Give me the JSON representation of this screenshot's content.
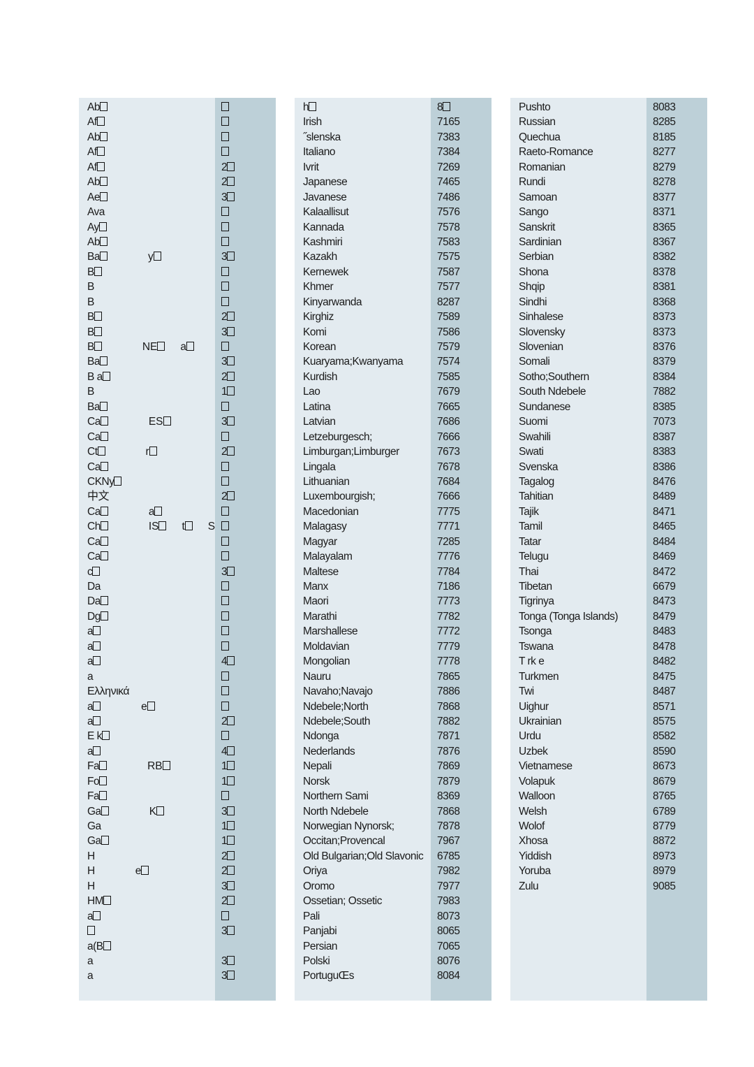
{
  "page": {
    "background": "#ffffff",
    "panel_name_bg": "#e3ebf0",
    "panel_code_bg": "#bdd0d8",
    "text_color": "#1a1a1a",
    "description": "Language code reference table, three columns. First column renders with missing font glyphs (tofu boxes)."
  },
  "columns": [
    {
      "name": "column-1-corrupted",
      "legible": false,
      "note": "Glyphs fail to render; shown as overlapping letters and empty boxes.",
      "rows": [
        {
          "name_text": "Ab",
          "name_boxes": 1,
          "code_text": "",
          "code_boxes": 1
        },
        {
          "name_text": "Af",
          "name_boxes": 1,
          "code_text": "",
          "code_boxes": 1
        },
        {
          "name_text": "Ab",
          "name_boxes": 1,
          "code_text": "",
          "code_boxes": 1
        },
        {
          "name_text": "Af",
          "name_boxes": 1,
          "code_text": "",
          "code_boxes": 1
        },
        {
          "name_text": "Af",
          "name_boxes": 1,
          "code_text": "2",
          "code_boxes": 1
        },
        {
          "name_text": "Ab",
          "name_boxes": 1,
          "code_text": "2",
          "code_boxes": 1
        },
        {
          "name_text": "Ae",
          "name_boxes": 1,
          "code_text": "3",
          "code_boxes": 1
        },
        {
          "name_text": "Ava",
          "name_boxes": 0,
          "code_text": "",
          "code_boxes": 1
        },
        {
          "name_text": "Ay",
          "name_boxes": 1,
          "code_text": "",
          "code_boxes": 1
        },
        {
          "name_text": "Ab",
          "name_boxes": 1,
          "code_text": "",
          "code_boxes": 1
        },
        {
          "name_text": "Ba",
          "name_boxes": 1,
          "name_extra": "y",
          "code_text": "3",
          "code_boxes": 1
        },
        {
          "name_text": "B",
          "name_boxes": 1,
          "code_text": "",
          "code_boxes": 1
        },
        {
          "name_text": "B",
          "name_boxes": 0,
          "code_text": "",
          "code_boxes": 1
        },
        {
          "name_text": "B",
          "name_boxes": 0,
          "code_text": "",
          "code_boxes": 1
        },
        {
          "name_text": "B",
          "name_boxes": 1,
          "code_text": "2",
          "code_boxes": 1
        },
        {
          "name_text": "B",
          "name_boxes": 1,
          "code_text": "3",
          "code_boxes": 1
        },
        {
          "name_text": "B",
          "name_boxes": 1,
          "name_extra": "NE",
          "name_extra2": "a",
          "code_text": "",
          "code_boxes": 1
        },
        {
          "name_text": "Ba",
          "name_boxes": 1,
          "code_text": "3",
          "code_boxes": 1
        },
        {
          "name_text": "B a",
          "name_boxes": 1,
          "code_text": "2",
          "code_boxes": 1
        },
        {
          "name_text": "B",
          "name_boxes": 0,
          "code_text": "1",
          "code_boxes": 1
        },
        {
          "name_text": "Ba",
          "name_boxes": 1,
          "code_text": "",
          "code_boxes": 1
        },
        {
          "name_text": "Ca",
          "name_boxes": 1,
          "name_extra": "ES",
          "code_text": "3",
          "code_boxes": 1
        },
        {
          "name_text": "Ca",
          "name_boxes": 1,
          "code_text": "",
          "code_boxes": 1
        },
        {
          "name_text": "Ct",
          "name_boxes": 1,
          "name_extra": "r",
          "code_text": "2",
          "code_boxes": 1
        },
        {
          "name_text": "Ca",
          "name_boxes": 1,
          "code_text": "",
          "code_boxes": 1
        },
        {
          "name_text": "CKNy",
          "name_boxes": 1,
          "code_text": "",
          "code_boxes": 1
        },
        {
          "name_text": "中文",
          "name_boxes": 0,
          "code_text": "2",
          "code_boxes": 1,
          "cjk": true
        },
        {
          "name_text": "Ca",
          "name_boxes": 1,
          "name_extra": "a",
          "code_text": "",
          "code_boxes": 1
        },
        {
          "name_text": "Ch",
          "name_boxes": 1,
          "name_extra": "IS",
          "name_extra2": "t",
          "name_extra3": "S vo",
          "code_text": "",
          "code_boxes": 1
        },
        {
          "name_text": "Ca",
          "name_boxes": 1,
          "code_text": "",
          "code_boxes": 1
        },
        {
          "name_text": "Ca",
          "name_boxes": 1,
          "code_text": "",
          "code_boxes": 1
        },
        {
          "name_text": "c",
          "name_boxes": 1,
          "code_text": "3",
          "code_boxes": 1
        },
        {
          "name_text": "Da",
          "name_boxes": 0,
          "code_text": "",
          "code_boxes": 1
        },
        {
          "name_text": "Da",
          "name_boxes": 1,
          "code_text": "",
          "code_boxes": 1
        },
        {
          "name_text": "Dg",
          "name_boxes": 1,
          "code_text": "",
          "code_boxes": 1
        },
        {
          "name_text": "a",
          "name_boxes": 1,
          "code_text": "",
          "code_boxes": 1
        },
        {
          "name_text": "a",
          "name_boxes": 1,
          "code_text": "",
          "code_boxes": 1
        },
        {
          "name_text": "a",
          "name_boxes": 1,
          "code_text": "4",
          "code_boxes": 1
        },
        {
          "name_text": "a",
          "name_boxes": 0,
          "code_text": "",
          "code_boxes": 1
        },
        {
          "name_text": "Ελληνικά",
          "name_boxes": 0,
          "code_text": "",
          "code_boxes": 1,
          "greek": true
        },
        {
          "name_text": "a",
          "name_boxes": 1,
          "name_extra": "e",
          "name_extra_box": true,
          "code_text": "",
          "code_boxes": 1
        },
        {
          "name_text": "a",
          "name_boxes": 1,
          "code_text": "2",
          "code_boxes": 1
        },
        {
          "name_text": "E k",
          "name_boxes": 1,
          "code_text": "",
          "code_boxes": 1
        },
        {
          "name_text": "a",
          "name_boxes": 1,
          "code_text": "4",
          "code_boxes": 1
        },
        {
          "name_text": "Fa",
          "name_boxes": 1,
          "name_extra": "RB",
          "code_text": "1",
          "code_boxes": 1
        },
        {
          "name_text": "Fo",
          "name_boxes": 1,
          "code_text": "1",
          "code_boxes": 1
        },
        {
          "name_text": "Fa",
          "name_boxes": 1,
          "code_text": "",
          "code_boxes": 1
        },
        {
          "name_text": "Ga",
          "name_boxes": 1,
          "name_extra": "K",
          "code_text": "3",
          "code_boxes": 1
        },
        {
          "name_text": "Ga",
          "name_boxes": 0,
          "code_text": "1",
          "code_boxes": 1
        },
        {
          "name_text": "Ga",
          "name_boxes": 1,
          "code_text": "1",
          "code_boxes": 1
        },
        {
          "name_text": "H",
          "name_boxes": 0,
          "code_text": "2",
          "code_boxes": 1
        },
        {
          "name_text": "H",
          "name_boxes": 0,
          "name_extra": "e",
          "name_extra_box": true,
          "code_text": "2",
          "code_boxes": 1
        },
        {
          "name_text": "H",
          "name_boxes": 0,
          "code_text": "3",
          "code_boxes": 1
        },
        {
          "name_text": "HM",
          "name_boxes": 1,
          "code_text": "2",
          "code_boxes": 1
        },
        {
          "name_text": "a",
          "name_boxes": 1,
          "code_text": "",
          "code_boxes": 1
        },
        {
          "name_text": "",
          "name_boxes": 1,
          "code_text": "3",
          "code_boxes": 1
        },
        {
          "name_text": "a(B",
          "name_boxes": 1,
          "code_text": "",
          "code_boxes": 0
        },
        {
          "name_text": "a",
          "name_boxes": 0,
          "code_text": "3",
          "code_boxes": 1
        },
        {
          "name_text": "a",
          "name_boxes": 0,
          "code_text": "3",
          "code_boxes": 1
        }
      ]
    },
    {
      "name": "column-2",
      "legible": true,
      "rows": [
        {
          "name_text": "h",
          "name_boxes": 1,
          "code_text": "8",
          "code_boxes": 1,
          "corrupt": true
        },
        {
          "name_text": "Irish",
          "code_text": "7165"
        },
        {
          "name_text": "˝slenska",
          "code_text": "7383"
        },
        {
          "name_text": "Italiano",
          "code_text": "7384"
        },
        {
          "name_text": "Ivrit",
          "code_text": "7269"
        },
        {
          "name_text": "Japanese",
          "code_text": "7465"
        },
        {
          "name_text": "Javanese",
          "code_text": "7486"
        },
        {
          "name_text": "Kalaallisut",
          "code_text": "7576"
        },
        {
          "name_text": "Kannada",
          "code_text": "7578"
        },
        {
          "name_text": "Kashmiri",
          "code_text": "7583"
        },
        {
          "name_text": "Kazakh",
          "code_text": "7575"
        },
        {
          "name_text": "Kernewek",
          "code_text": "7587"
        },
        {
          "name_text": "Khmer",
          "code_text": "7577"
        },
        {
          "name_text": "Kinyarwanda",
          "code_text": "8287"
        },
        {
          "name_text": "Kirghiz",
          "code_text": "7589"
        },
        {
          "name_text": "Komi",
          "code_text": "7586"
        },
        {
          "name_text": "Korean",
          "code_text": "7579"
        },
        {
          "name_text": "Kuaryama;Kwanyama",
          "code_text": "7574"
        },
        {
          "name_text": "Kurdish",
          "code_text": "7585"
        },
        {
          "name_text": "Lao",
          "code_text": "7679"
        },
        {
          "name_text": "Latina",
          "code_text": "7665"
        },
        {
          "name_text": "Latvian",
          "code_text": "7686"
        },
        {
          "name_text": "Letzeburgesch;",
          "code_text": "7666"
        },
        {
          "name_text": "Limburgan;Limburger",
          "code_text": "7673"
        },
        {
          "name_text": "Lingala",
          "code_text": "7678"
        },
        {
          "name_text": "Lithuanian",
          "code_text": "7684"
        },
        {
          "name_text": "Luxembourgish;",
          "code_text": "7666"
        },
        {
          "name_text": "Macedonian",
          "code_text": "7775"
        },
        {
          "name_text": "Malagasy",
          "code_text": "7771"
        },
        {
          "name_text": "Magyar",
          "code_text": "7285"
        },
        {
          "name_text": "Malayalam",
          "code_text": "7776"
        },
        {
          "name_text": "Maltese",
          "code_text": "7784"
        },
        {
          "name_text": "Manx",
          "code_text": "7186"
        },
        {
          "name_text": "Maori",
          "code_text": "7773"
        },
        {
          "name_text": "Marathi",
          "code_text": "7782"
        },
        {
          "name_text": "Marshallese",
          "code_text": "7772"
        },
        {
          "name_text": "Moldavian",
          "code_text": "7779"
        },
        {
          "name_text": "Mongolian",
          "code_text": "7778"
        },
        {
          "name_text": "Nauru",
          "code_text": "7865"
        },
        {
          "name_text": "Navaho;Navajo",
          "code_text": "7886"
        },
        {
          "name_text": "Ndebele;North",
          "code_text": "7868"
        },
        {
          "name_text": "Ndebele;South",
          "code_text": "7882"
        },
        {
          "name_text": "Ndonga",
          "code_text": "7871"
        },
        {
          "name_text": "Nederlands",
          "code_text": "7876"
        },
        {
          "name_text": "Nepali",
          "code_text": "7869"
        },
        {
          "name_text": "Norsk",
          "code_text": "7879"
        },
        {
          "name_text": "Northern Sami",
          "code_text": "8369"
        },
        {
          "name_text": "North Ndebele",
          "code_text": "7868"
        },
        {
          "name_text": "Norwegian Nynorsk;",
          "code_text": "7878"
        },
        {
          "name_text": "Occitan;Provencal",
          "code_text": "7967"
        },
        {
          "name_text": "Old Bulgarian;Old Slavonic",
          "code_text": "6785"
        },
        {
          "name_text": "Oriya",
          "code_text": "7982"
        },
        {
          "name_text": "Oromo",
          "code_text": "7977"
        },
        {
          "name_text": "Ossetian; Ossetic",
          "code_text": "7983"
        },
        {
          "name_text": "Pali",
          "code_text": "8073"
        },
        {
          "name_text": "Panjabi",
          "code_text": "8065"
        },
        {
          "name_text": "Persian",
          "code_text": "7065"
        },
        {
          "name_text": "Polski",
          "code_text": "8076"
        },
        {
          "name_text": "PortuguŒs",
          "code_text": "8084"
        }
      ]
    },
    {
      "name": "column-3",
      "legible": true,
      "rows": [
        {
          "name_text": "Pushto",
          "code_text": "8083"
        },
        {
          "name_text": "Russian",
          "code_text": "8285"
        },
        {
          "name_text": "Quechua",
          "code_text": "8185"
        },
        {
          "name_text": "Raeto-Romance",
          "code_text": "8277"
        },
        {
          "name_text": "Romanian",
          "code_text": "8279"
        },
        {
          "name_text": "Rundi",
          "code_text": "8278"
        },
        {
          "name_text": "Samoan",
          "code_text": "8377"
        },
        {
          "name_text": "Sango",
          "code_text": "8371"
        },
        {
          "name_text": "Sanskrit",
          "code_text": "8365"
        },
        {
          "name_text": "Sardinian",
          "code_text": "8367"
        },
        {
          "name_text": "Serbian",
          "code_text": "8382"
        },
        {
          "name_text": "Shona",
          "code_text": "8378"
        },
        {
          "name_text": "Shqip",
          "code_text": "8381"
        },
        {
          "name_text": "Sindhi",
          "code_text": "8368"
        },
        {
          "name_text": "Sinhalese",
          "code_text": "8373"
        },
        {
          "name_text": "Slovensky",
          "code_text": "8373"
        },
        {
          "name_text": "Slovenian",
          "code_text": "8376"
        },
        {
          "name_text": "Somali",
          "code_text": "8379"
        },
        {
          "name_text": "Sotho;Southern",
          "code_text": "8384"
        },
        {
          "name_text": "South Ndebele",
          "code_text": "7882"
        },
        {
          "name_text": "Sundanese",
          "code_text": "8385"
        },
        {
          "name_text": "Suomi",
          "code_text": "7073"
        },
        {
          "name_text": "Swahili",
          "code_text": "8387"
        },
        {
          "name_text": "Swati",
          "code_text": "8383"
        },
        {
          "name_text": "Svenska",
          "code_text": "8386"
        },
        {
          "name_text": "Tagalog",
          "code_text": "8476"
        },
        {
          "name_text": "Tahitian",
          "code_text": "8489"
        },
        {
          "name_text": "Tajik",
          "code_text": "8471"
        },
        {
          "name_text": "Tamil",
          "code_text": "8465"
        },
        {
          "name_text": "Tatar",
          "code_text": "8484"
        },
        {
          "name_text": "Telugu",
          "code_text": "8469"
        },
        {
          "name_text": "Thai",
          "code_text": "8472"
        },
        {
          "name_text": "Tibetan",
          "code_text": "6679"
        },
        {
          "name_text": "Tigrinya",
          "code_text": "8473"
        },
        {
          "name_text": "Tonga (Tonga Islands)",
          "code_text": "8479"
        },
        {
          "name_text": "Tsonga",
          "code_text": "8483"
        },
        {
          "name_text": "Tswana",
          "code_text": "8478"
        },
        {
          "name_text": "T rk e",
          "code_text": "8482"
        },
        {
          "name_text": "Turkmen",
          "code_text": "8475"
        },
        {
          "name_text": "Twi",
          "code_text": "8487"
        },
        {
          "name_text": "Uighur",
          "code_text": "8571"
        },
        {
          "name_text": "Ukrainian",
          "code_text": "8575"
        },
        {
          "name_text": "Urdu",
          "code_text": "8582"
        },
        {
          "name_text": "Uzbek",
          "code_text": "8590"
        },
        {
          "name_text": "Vietnamese",
          "code_text": "8673"
        },
        {
          "name_text": "Volapuk",
          "code_text": "8679"
        },
        {
          "name_text": "Walloon",
          "code_text": "8765"
        },
        {
          "name_text": "Welsh",
          "code_text": "6789"
        },
        {
          "name_text": "Wolof",
          "code_text": "8779"
        },
        {
          "name_text": "Xhosa",
          "code_text": "8872"
        },
        {
          "name_text": "Yiddish",
          "code_text": "8973"
        },
        {
          "name_text": "Yoruba",
          "code_text": "8979"
        },
        {
          "name_text": "Zulu",
          "code_text": "9085"
        }
      ]
    }
  ]
}
